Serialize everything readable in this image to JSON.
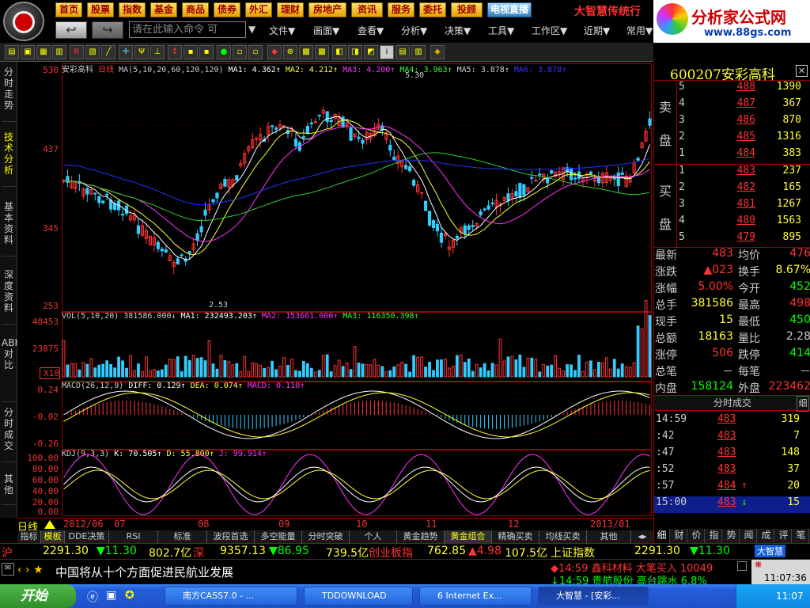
{
  "topmenu": [
    "首页",
    "股票",
    "指数",
    "基金",
    "商品",
    "债券",
    "外汇",
    "理财",
    "房地产",
    "资讯",
    "服务",
    "委托",
    "投顾"
  ],
  "topmenu_alt": "电视直播",
  "app_title": "大智慧传统行",
  "brand": {
    "name": "分析家公式网",
    "url": "www.88gs.com"
  },
  "nav": {
    "back": "↩",
    "forward": "↪",
    "cmd_placeholder": "请在此输入命令  可"
  },
  "menu2": [
    "文件▼",
    "画面▼",
    "查看▼",
    "分析▼",
    "决策▼",
    "工具▼",
    "工作区▼",
    "近期▼",
    "常用▼"
  ],
  "left_tabs": [
    "分时走势",
    "技术分析",
    "基本资料",
    "深度资料",
    "ABH对比",
    "分时成交",
    "其他"
  ],
  "main_legend": {
    "name": "安彩高科",
    "period": "日线",
    "ma_params": "MA(5,10,20,60,120,120)",
    "ma1": "MA1: 4.362↑",
    "ma2": "MA2: 4.212↑",
    "ma3": "MA3: 4.200↑",
    "ma4": "MA4: 3.963↑",
    "ma5": "MA5: 3.878↑",
    "ma6": "MA6: 3.878↑",
    "high_note": "5.30",
    "low_note": "2.53"
  },
  "vol_legend": {
    "p": "VOL(5,10,20)",
    "v": "381586.000↓",
    "ma1": "MA1: 232493.203↑",
    "ma2": "MA2: 153661.000↑",
    "ma3": "MA3: 116350.398↑"
  },
  "macd_legend": {
    "p": "MACD(26,12,9)",
    "diff": "DIFF: 0.129↑",
    "dea": "DEA: 0.074↑",
    "macd": "MACD: 0.110↑"
  },
  "kdj_legend": {
    "p": "KDJ(9,3,3)",
    "k": "K: 70.505↑",
    "d": "D: 55.800↑",
    "j": "J: 99.914↑"
  },
  "yaxis": {
    "main": [
      "530",
      "437",
      "345",
      "253"
    ],
    "vol": [
      "48453",
      "23875",
      "X10"
    ],
    "macd": [
      "0.24",
      "-0.02",
      "-0.26"
    ],
    "kdj": [
      "100.00",
      "80.00",
      "60.00",
      "40.00",
      "20.00",
      "0.00"
    ]
  },
  "dates": {
    "day": "日线",
    "labels": [
      "2012/06",
      "07",
      "08",
      "09",
      "10",
      "11",
      "12",
      "2013/01"
    ]
  },
  "bottom_tabs": [
    "指标",
    "模板",
    "DDE决策",
    "RSI",
    "标准",
    "波段首选",
    "多空能量",
    "分时突破",
    "个人",
    "黄金趋势",
    "黄金组合",
    "精确买卖",
    "均线买卖",
    "其他"
  ],
  "stock": {
    "code": "600207",
    "name": "安彩高科",
    "close": "✕"
  },
  "orderbook": {
    "sell_label": [
      "卖",
      "盘"
    ],
    "buy_label": [
      "买",
      "盘"
    ],
    "sell": [
      [
        "5",
        "488",
        "1390"
      ],
      [
        "4",
        "487",
        "367"
      ],
      [
        "3",
        "486",
        "870"
      ],
      [
        "2",
        "485",
        "1316"
      ],
      [
        "1",
        "484",
        "383"
      ]
    ],
    "buy": [
      [
        "1",
        "483",
        "237"
      ],
      [
        "2",
        "482",
        "165"
      ],
      [
        "3",
        "481",
        "1267"
      ],
      [
        "4",
        "480",
        "1563"
      ],
      [
        "5",
        "479",
        "895"
      ]
    ]
  },
  "stats": [
    {
      "k": "最新",
      "v": "483",
      "vc": "#f33",
      "k2": "均价",
      "v2": "476",
      "v2c": "#f33"
    },
    {
      "k": "涨跌",
      "v": "▲023",
      "vc": "#f33",
      "k2": "换手",
      "v2": "8.67%",
      "v2c": "#ff3"
    },
    {
      "k": "涨幅",
      "v": "5.00%",
      "vc": "#f33",
      "k2": "今开",
      "v2": "452",
      "v2c": "#0f0"
    },
    {
      "k": "总手",
      "v": "381586",
      "vc": "#ff3",
      "k2": "最高",
      "v2": "498",
      "v2c": "#f33"
    },
    {
      "k": "现手",
      "v": "15",
      "vc": "#ff3",
      "k2": "最低",
      "v2": "450",
      "v2c": "#0f0"
    },
    {
      "k": "总额",
      "v": "18163",
      "vc": "#ff3",
      "k2": "量比",
      "v2": "2.28",
      "v2c": "#ccc"
    },
    {
      "k": "涨停",
      "v": "506",
      "vc": "#f33",
      "k2": "跌停",
      "v2": "414",
      "v2c": "#0f0"
    },
    {
      "k": "总笔",
      "v": "－",
      "vc": "#ccc",
      "k2": "每笔",
      "v2": "－",
      "v2c": "#ccc"
    },
    {
      "k": "内盘",
      "v": "158124",
      "vc": "#0f0",
      "k2": "外盘",
      "v2": "223462",
      "v2c": "#f33"
    }
  ],
  "ticks_header": "分时成交",
  "ticks_tab": "细",
  "ticks": [
    {
      "t": "14:59",
      "p": "483",
      "v": "319",
      "mark": ""
    },
    {
      "t": "  :42",
      "p": "483",
      "v": "7",
      "mark": ""
    },
    {
      "t": "  :47",
      "p": "483",
      "v": "148",
      "mark": ""
    },
    {
      "t": "  :52",
      "p": "483",
      "v": "37",
      "mark": ""
    },
    {
      "t": "  :57",
      "p": "484",
      "v": "20",
      "mark": "↑"
    },
    {
      "t": "15:00",
      "p": "483",
      "v": "15",
      "mark": "↓"
    }
  ],
  "right_tabs": [
    "细",
    "财",
    "价",
    "指",
    "势",
    "闻",
    "成",
    "评",
    "笔"
  ],
  "ticker": {
    "sh": "沪",
    "sh_v": "2291.30",
    "sh_c": "▼11.30",
    "sh_a": "802.7亿",
    "sz": "深",
    "sz_v": "9357.13",
    "sz_c": "▼86.95",
    "sz_a": "739.5亿",
    "cy": "创业板指",
    "cy_v": "762.85",
    "cy_c": "▲4.98",
    "cy_a": "107.5亿",
    "idx": "上证指数",
    "idx_v": "2291.30",
    "idx_c": "▼11.30",
    "logo": "大智慧"
  },
  "news": {
    "headline": "中国将从十个方面促进民航业发展",
    "alert1": "◆14:59 鑫科材料 大笔买入 10049",
    "alert2": "↓14:59 贵航股份 高台跳水 6.8%",
    "clock": "11:07:36"
  },
  "taskbar": {
    "start": "开始",
    "tasks": [
      "南方CASS7.0 - ...",
      "TDDOWNLOAD",
      "6 Internet Ex...",
      "大智慧 - [安彩..."
    ],
    "time": "11:07"
  }
}
